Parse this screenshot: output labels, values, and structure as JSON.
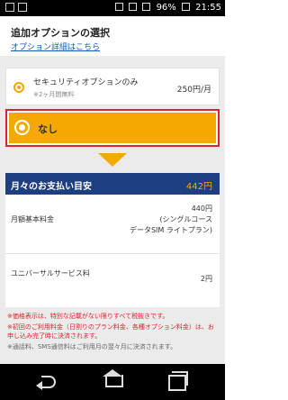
{
  "status_bar": {
    "battery": "96%",
    "time": "21:55",
    "icons": [
      "notification-icon",
      "image-icon",
      "mail-icon",
      "wifi-icon",
      "signal-icon",
      "battery-icon"
    ]
  },
  "header": {
    "title": "追加オプションの選択",
    "details_link": "オプション詳細はこちら"
  },
  "options": [
    {
      "label": "セキュリティオプションのみ",
      "note": "※2ヶ月間無料",
      "price": "250円/月",
      "selected": false
    },
    {
      "label": "なし",
      "selected": true
    }
  ],
  "summary": {
    "title": "月々のお支払い目安",
    "total": "442円",
    "rows": [
      {
        "label": "月額基本料金",
        "value_lines": [
          "440円",
          "(シングルコース",
          "データSIM ライトプラン)"
        ]
      },
      {
        "label": "ユニバーサルサービス料",
        "value_lines": [
          "2円"
        ]
      }
    ]
  },
  "notes": [
    {
      "text": "※価格表示は、特別な記載がない限りすべて税抜きです。",
      "color": "red"
    },
    {
      "text": "※初回のご利用料金（日割りのプラン料金、各種オプション料金）は、お申し込み完了時に決済されます。",
      "color": "red"
    },
    {
      "text": "※通話料、SMS通信料はご利用月の翌々月に決済されます。",
      "color": "gray"
    }
  ],
  "colors": {
    "accent": "#f5a800",
    "navy": "#1d3f80",
    "alert_red": "#d9232d",
    "link_blue": "#1a5bb8"
  }
}
